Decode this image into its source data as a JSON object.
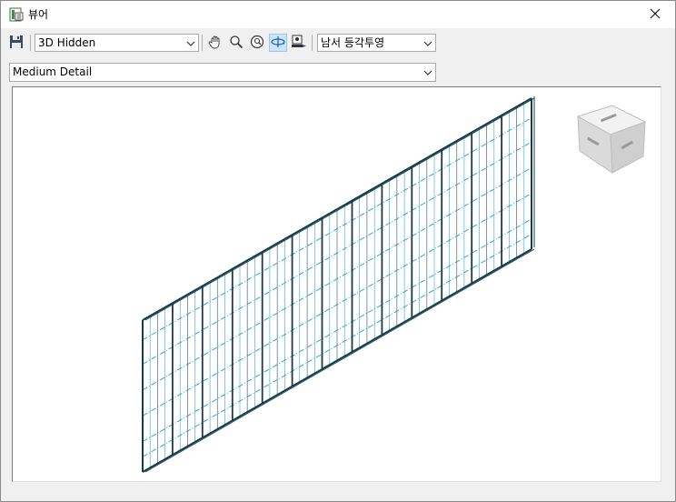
{
  "window": {
    "title": "뷰어",
    "app_icon": "viewer-app-icon",
    "close_icon": "close-icon"
  },
  "toolbar": {
    "save_icon": "save-icon",
    "visual_style": {
      "selected": "3D Hidden"
    },
    "tools": [
      {
        "name": "pan-icon",
        "active": false
      },
      {
        "name": "zoom-icon",
        "active": false
      },
      {
        "name": "zoom-extents-icon",
        "active": false
      },
      {
        "name": "orbit-icon",
        "active": true
      },
      {
        "name": "camera-settings-icon",
        "active": false
      }
    ],
    "view_direction": {
      "selected": "남서 등각투영"
    }
  },
  "detail_level": {
    "selected": "Medium Detail"
  },
  "viewport": {
    "model": "curtain-wall-grid",
    "viewcube": "viewcube-icon",
    "colors": {
      "outline": "#143c4c",
      "grid": "#3aa3cf",
      "mullion": "#1e3a48"
    }
  }
}
